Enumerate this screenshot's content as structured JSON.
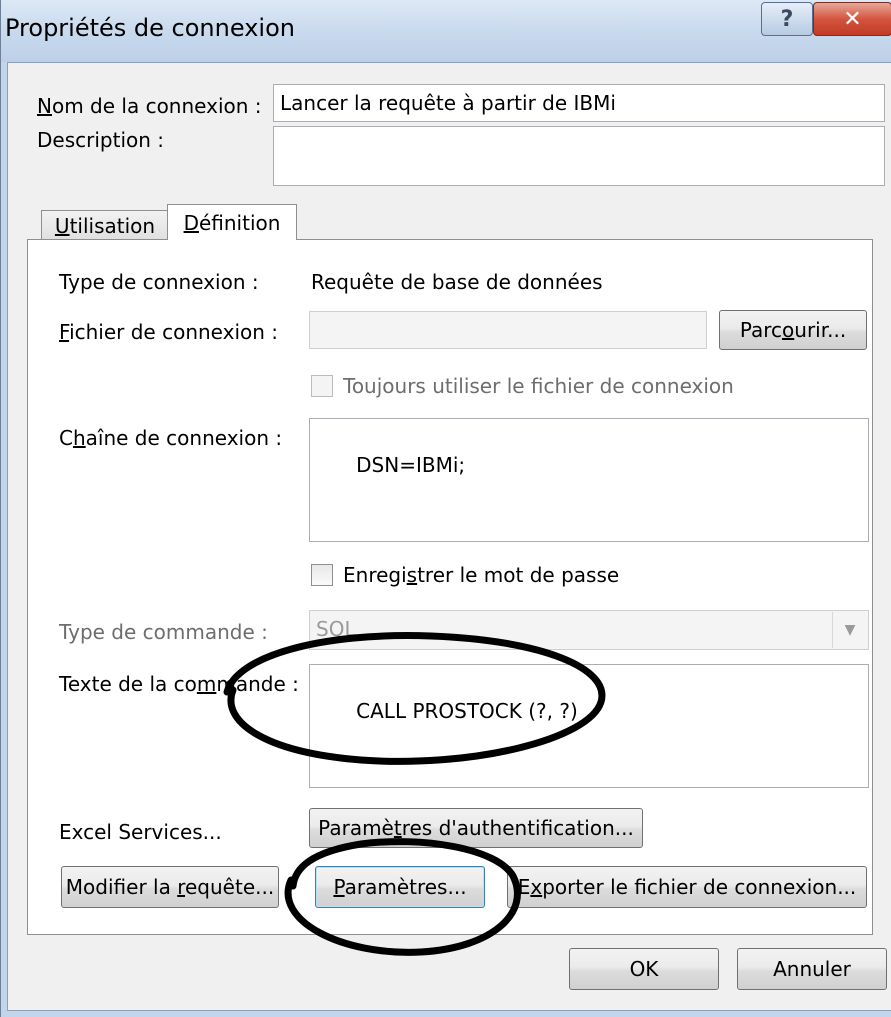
{
  "window": {
    "title": "Propriétés de connexion",
    "help_glyph": "?",
    "close_glyph": "✕"
  },
  "general": {
    "name_label": "Nom de la connexion :",
    "name_accel": "N",
    "name_rest": "om de la connexion :",
    "name_value": "Lancer la requête à partir de IBMi",
    "description_label": "Description :",
    "description_value": ""
  },
  "tabs": [
    {
      "label": "Utilisation",
      "accel": "U",
      "rest": "tilisation",
      "active": false
    },
    {
      "label": "Définition",
      "accel": "D",
      "rest": "éfinition",
      "active": true
    }
  ],
  "definition": {
    "connection_type_label": "Type de connexion :",
    "connection_type_value": "Requête de base de données",
    "connection_file_label_accel": "F",
    "connection_file_label_rest": "ichier de connexion :",
    "connection_file_value": "",
    "browse_button_pre": "Parc",
    "browse_button_accel": "o",
    "browse_button_post": "urir...",
    "always_use_file_label": "Toujours utiliser le fichier de connexion",
    "connection_string_label_pre": "C",
    "connection_string_label_accel": "h",
    "connection_string_label_post": "aîne de connexion :",
    "connection_string_value": "DSN=IBMi;",
    "save_password_pre": "Enregi",
    "save_password_accel": "s",
    "save_password_post": "trer le mot de passe",
    "command_type_label": "Type de commande :",
    "command_type_value": "SQL",
    "command_text_label_pre": "Texte de la co",
    "command_text_label_accel": "m",
    "command_text_label_post": "mande :",
    "command_text_value": "CALL PROSTOCK (?, ?)",
    "excel_services_label": "Excel Services...",
    "auth_button_pre": "Paramè",
    "auth_button_accel": "t",
    "auth_button_post": "res d'authentification...",
    "edit_query_pre": "Modifier la ",
    "edit_query_accel": "r",
    "edit_query_post": "equête...",
    "parameters_accel": "P",
    "parameters_post": "aramètres...",
    "export_pre": "E",
    "export_accel": "x",
    "export_post": "porter le fichier de connexion..."
  },
  "footer": {
    "ok_label": "OK",
    "cancel_label": "Annuler"
  },
  "colors": {
    "title_bar": "#c9daee",
    "close_button": "#c13b25",
    "annotation_ink": "#000000"
  }
}
